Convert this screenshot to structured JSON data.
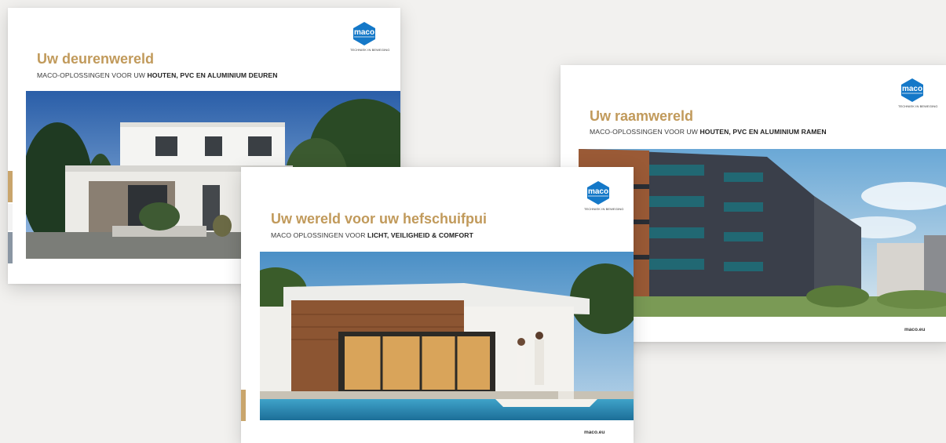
{
  "brochures": {
    "doors": {
      "title": "Uw deurenwereld",
      "subtitle_plain": "MACO-OPLOSSINGEN VOOR UW ",
      "subtitle_bold": "HOUTEN, PVC EN ALUMINIUM DEUREN",
      "logo_tagline": "TECHNIEK IN BEWEGING"
    },
    "windows": {
      "title": "Uw raamwereld",
      "subtitle_plain": "MACO-OPLOSSINGEN VOOR UW ",
      "subtitle_bold": "HOUTEN, PVC EN ALUMINIUM RAMEN",
      "logo_tagline": "TECHNIEK IN BEWEGING",
      "site": "maco.eu"
    },
    "slide": {
      "title": "Uw wereld voor uw hefschuifpui",
      "subtitle_plain": "MACO OPLOSSINGEN VOOR ",
      "subtitle_bold": "LICHT, VEILIGHEID & COMFORT",
      "logo_tagline": "TECHNIEK IN BEWEGING",
      "site": "maco.eu"
    }
  },
  "colors": {
    "title_gold": "#c19a5b",
    "logo_blue": "#1478c8",
    "background": "#f2f1ef"
  }
}
